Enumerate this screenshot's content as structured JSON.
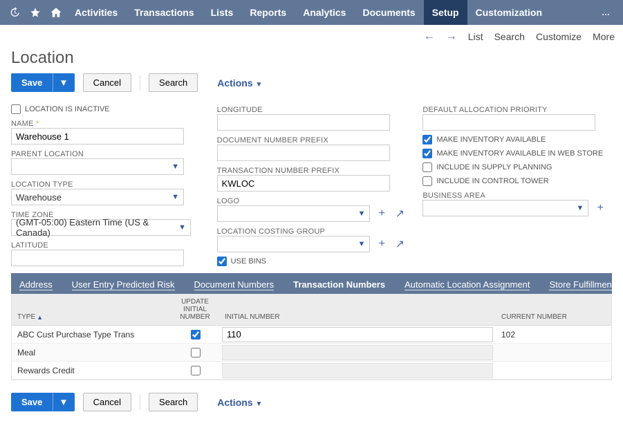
{
  "topnav": {
    "items": [
      "Activities",
      "Transactions",
      "Lists",
      "Reports",
      "Analytics",
      "Documents",
      "Setup",
      "Customization"
    ],
    "active_index": 6
  },
  "subnav": {
    "list": "List",
    "search": "Search",
    "customize": "Customize",
    "more": "More"
  },
  "page": {
    "title": "Location"
  },
  "buttons": {
    "save": "Save",
    "cancel": "Cancel",
    "search": "Search",
    "actions": "Actions"
  },
  "left": {
    "inactive_label": "LOCATION IS INACTIVE",
    "inactive": false,
    "name_label": "NAME",
    "name": "Warehouse 1",
    "parent_label": "PARENT LOCATION",
    "parent": "",
    "type_label": "LOCATION TYPE",
    "type": "Warehouse",
    "tz_label": "TIME ZONE",
    "tz": "(GMT-05:00) Eastern Time (US & Canada)",
    "lat_label": "LATITUDE",
    "lat": ""
  },
  "mid": {
    "long_label": "LONGITUDE",
    "long": "",
    "docprefix_label": "DOCUMENT NUMBER PREFIX",
    "docprefix": "",
    "txnprefix_label": "TRANSACTION NUMBER PREFIX",
    "txnprefix": "KWLOC",
    "logo_label": "LOGO",
    "logo": "",
    "costgroup_label": "LOCATION COSTING GROUP",
    "costgroup": "",
    "usebins_label": "USE BINS",
    "usebins": true
  },
  "right": {
    "allocprio_label": "DEFAULT ALLOCATION PRIORITY",
    "allocprio": "",
    "inv_avail_label": "MAKE INVENTORY AVAILABLE",
    "inv_avail": true,
    "inv_web_label": "MAKE INVENTORY AVAILABLE IN WEB STORE",
    "inv_web": true,
    "supply_label": "INCLUDE IN SUPPLY PLANNING",
    "supply": false,
    "tower_label": "INCLUDE IN CONTROL TOWER",
    "tower": false,
    "bizarea_label": "BUSINESS AREA",
    "bizarea": ""
  },
  "tabs": {
    "items": [
      {
        "label": "Address",
        "underline": true
      },
      {
        "label": "User Entry Predicted Risk",
        "underline": true
      },
      {
        "label": "Document Numbers",
        "underline": true
      },
      {
        "label": "Transaction Numbers",
        "underline": false,
        "active": true
      },
      {
        "label": "Automatic Location Assignment",
        "underline": true
      },
      {
        "label": "Store Fulfillment",
        "underline": true
      }
    ]
  },
  "grid": {
    "headers": {
      "type": "TYPE",
      "update": "UPDATE INITIAL NUMBER",
      "initial": "INITIAL NUMBER",
      "current": "CURRENT NUMBER"
    },
    "rows": [
      {
        "type": "ABC Cust Purchase Type Trans",
        "update": true,
        "initial": "110",
        "current": "102",
        "editable": true
      },
      {
        "type": "Meal",
        "update": false,
        "initial": "",
        "current": "",
        "editable": false
      },
      {
        "type": "Rewards Credit",
        "update": false,
        "initial": "",
        "current": "",
        "editable": false
      }
    ]
  }
}
